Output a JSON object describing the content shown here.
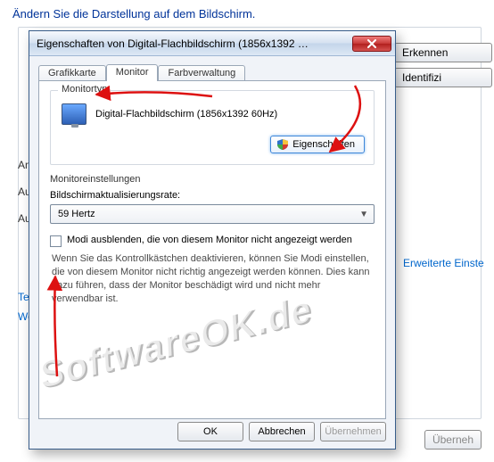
{
  "bg": {
    "heading": "Ändern Sie die Darstellung auf dem Bildschirm.",
    "btn_detect": "Erkennen",
    "btn_ident": "Identifizi",
    "row_anz": "Anz",
    "row_aufl": "Aufl",
    "row_aus": "Aus",
    "link_erw": "Erweiterte Einste",
    "link_text": "Text",
    "link_welt": "Wel",
    "btn_apply_bottom": "Überneh"
  },
  "dialog": {
    "title": "Eigenschaften von Digital-Flachbildschirm (1856x1392 …",
    "tabs": {
      "adapter": "Grafikkarte",
      "monitor": "Monitor",
      "color": "Farbverwaltung"
    },
    "monitortype": {
      "caption": "Monitortyp",
      "name": "Digital-Flachbildschirm (1856x1392 60Hz)",
      "props_btn": "Eigenschaften"
    },
    "settings": {
      "caption": "Monitoreinstellungen",
      "rate_label": "Bildschirmaktualisierungsrate:",
      "rate_value": "59 Hertz",
      "hide_modes": "Modi ausblenden, die von diesem Monitor nicht angezeigt werden",
      "help": "Wenn Sie das Kontrollkästchen deaktivieren, können Sie Modi einstellen, die von diesem Monitor nicht richtig angezeigt werden können. Dies kann dazu führen, dass der Monitor beschädigt wird und nicht mehr verwendbar ist."
    },
    "buttons": {
      "ok": "OK",
      "cancel": "Abbrechen",
      "apply": "Übernehmen"
    }
  },
  "watermark": "SoftwareOK.de"
}
